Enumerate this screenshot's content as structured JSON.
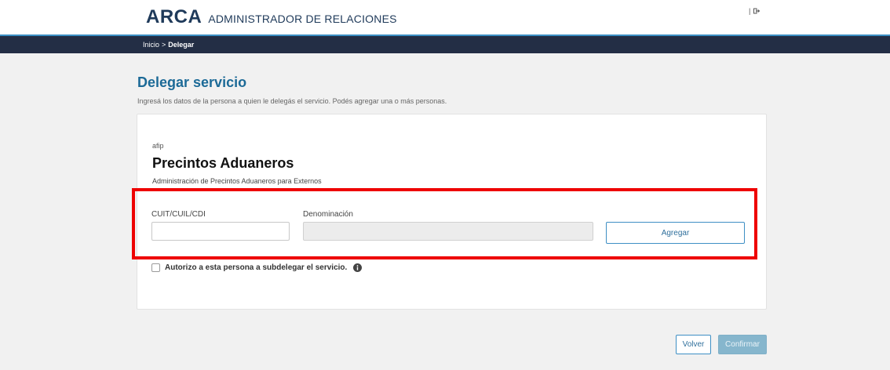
{
  "header": {
    "logo": "ARCA",
    "app_name": "ADMINISTRADOR DE RELACIONES",
    "separator": "|",
    "logout_icon": "logout-icon"
  },
  "breadcrumb": {
    "home": "Inicio",
    "separator": ">",
    "current": "Delegar"
  },
  "page": {
    "title": "Delegar servicio",
    "description": "Ingresá los datos de la persona a quien le delegás el servicio. Podés agregar una o más personas."
  },
  "service": {
    "org": "afip",
    "name": "Precintos Aduaneros",
    "description": "Administración de Precintos Aduaneros para Externos"
  },
  "form": {
    "cuit_label": "CUIT/CUIL/CDI",
    "cuit_value": "",
    "denominacion_label": "Denominación",
    "denominacion_value": "",
    "add_button": "Agregar",
    "subdelegate_label": "Autorizo a esta persona a subdelegar el servicio.",
    "subdelegate_checked": false,
    "info_icon": "info-icon"
  },
  "actions": {
    "back": "Volver",
    "confirm": "Confirmar"
  },
  "colors": {
    "navbar": "#232e45",
    "title": "#1c6a97",
    "highlight": "#ee0000",
    "accent": "#3e8fc4"
  }
}
